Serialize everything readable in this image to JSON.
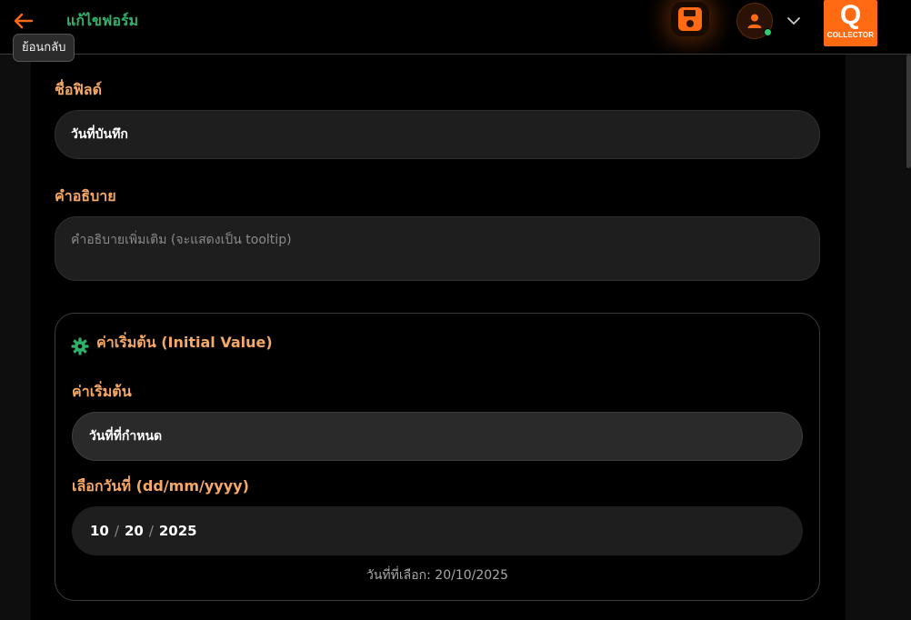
{
  "header": {
    "title": "แก้ไขฟอร์ม",
    "back_tooltip": "ย้อนกลับ",
    "logo_letter": "Q",
    "logo_text": "COLLECTOR",
    "accent_color": "#ff6a13",
    "title_color": "#2fb36a"
  },
  "form": {
    "field_name_label": "ชื่อฟิลด์",
    "field_name_value": "วันที่บันทึก",
    "description_label": "คำอธิบาย",
    "description_placeholder": "คำอธิบายเพิ่มเติม (จะแสดงเป็น tooltip)",
    "initial_section": {
      "title": "ค่าเริ่มต้น (Initial Value)",
      "default_label": "ค่าเริ่มต้น",
      "default_value": "วันที่ที่กำหนด",
      "date_label": "เลือกวันที่ (dd/mm/yyyy)",
      "date_month": "10",
      "date_day": "20",
      "date_year": "2025",
      "date_separator": "/",
      "selected_text": "วันที่ที่เลือก: 20/10/2025"
    }
  },
  "icons": {
    "back": "arrow-left-icon",
    "save": "floppy-disk-icon",
    "user": "user-icon",
    "chevron": "chevron-down-icon",
    "settings": "gear-icon"
  }
}
